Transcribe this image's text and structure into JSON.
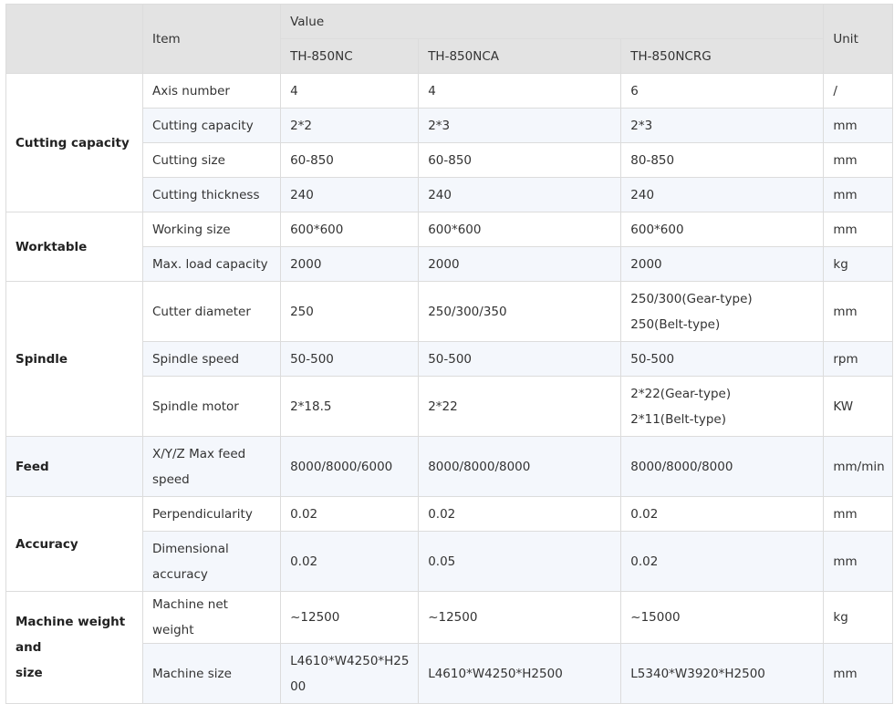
{
  "header": {
    "item": "Item",
    "value": "Value",
    "unit": "Unit",
    "models": [
      "TH-850NC",
      "TH-850NCA",
      "TH-850NCRG"
    ]
  },
  "groups": [
    {
      "name": "Cutting capacity",
      "rows": [
        {
          "item": "Axis number",
          "v": [
            "4",
            "4",
            "6"
          ],
          "unit": "/"
        },
        {
          "item": "Cutting capacity",
          "v": [
            "2*2",
            "2*3",
            "2*3"
          ],
          "unit": "mm"
        },
        {
          "item": "Cutting size",
          "v": [
            "60-850",
            "60-850",
            "80-850"
          ],
          "unit": "mm"
        },
        {
          "item": "Cutting thickness",
          "v": [
            "240",
            "240",
            "240"
          ],
          "unit": "mm"
        }
      ]
    },
    {
      "name": "Worktable",
      "rows": [
        {
          "item": "Working size",
          "v": [
            "600*600",
            "600*600",
            "600*600"
          ],
          "unit": "mm"
        },
        {
          "item": "Max. load capacity",
          "v": [
            "2000",
            "2000",
            "2000"
          ],
          "unit": "kg"
        }
      ]
    },
    {
      "name": "Spindle",
      "rows": [
        {
          "item": "Cutter diameter",
          "v": [
            "250",
            "250/300/350",
            "250/300(Gear-type)",
            "250(Belt-type)"
          ],
          "unit": "mm"
        },
        {
          "item": "Spindle speed",
          "v": [
            "50-500",
            "50-500",
            "50-500"
          ],
          "unit": "rpm"
        },
        {
          "item": "Spindle motor",
          "v": [
            "2*18.5",
            "2*22",
            "2*22(Gear-type)",
            "2*11(Belt-type)"
          ],
          "unit": "KW"
        }
      ]
    },
    {
      "name": "Feed",
      "rows": [
        {
          "item_l1": "X/Y/Z Max feed",
          "item_l2": "speed",
          "v": [
            "8000/8000/6000",
            "8000/8000/8000",
            "8000/8000/8000"
          ],
          "unit": "mm/min"
        }
      ]
    },
    {
      "name": "Accuracy",
      "rows": [
        {
          "item": "Perpendicularity",
          "v": [
            "0.02",
            "0.02",
            "0.02"
          ],
          "unit": "mm"
        },
        {
          "item_l1": "Dimensional",
          "item_l2": "accuracy",
          "v": [
            "0.02",
            "0.05",
            "0.02"
          ],
          "unit": "mm"
        }
      ]
    },
    {
      "name_l1": "Machine weight and",
      "name_l2": "size",
      "rows": [
        {
          "item": "Machine net weight",
          "v": [
            "~12500",
            "~12500",
            "~15000"
          ],
          "unit": "kg"
        },
        {
          "item": "Machine size",
          "v_l1": "L4610*W4250*H25",
          "v_l2": "00",
          "v": [
            "",
            "L4610*W4250*H2500",
            "L5340*W3920*H2500"
          ],
          "unit": "mm"
        }
      ]
    }
  ]
}
